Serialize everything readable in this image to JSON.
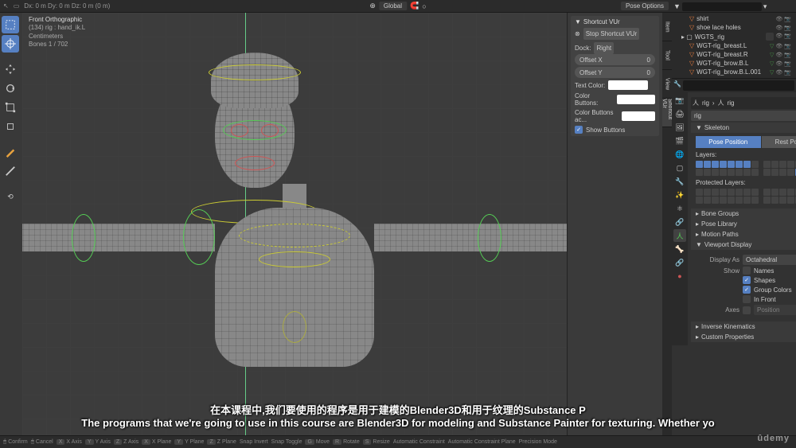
{
  "header": {
    "transform": "Dx: 0 m   Dy: 0 m   Dz: 0 m (0 m)",
    "orientation": "Global",
    "overlays": "Pose Options"
  },
  "viewport": {
    "view_name": "Front Orthographic",
    "object": "(134) rig : hand_ik.L",
    "units": "Centimeters",
    "bones": "Bones    1 / 702"
  },
  "shortcut_panel": {
    "title": "Shortcut VUr",
    "stop": "Stop Shortcut VUr",
    "dock_label": "Dock:",
    "dock_value": "Right",
    "offset_x_label": "Offset X",
    "offset_x_value": "0",
    "offset_y_label": "Offset Y",
    "offset_y_value": "0",
    "text_color": "Text Color:",
    "color_buttons": "Color Buttons:",
    "color_buttons_ac": "Color Buttons ac...",
    "show_buttons": "Show Buttons"
  },
  "tabs": {
    "item": "Item",
    "tool": "Tool",
    "view": "View",
    "shortcut": "Shortcut VUr"
  },
  "outliner": {
    "items": [
      {
        "name": "shirt"
      },
      {
        "name": "shoe lace holes"
      },
      {
        "name": "WGTS_rig"
      },
      {
        "name": "WGT-rig_breast.L"
      },
      {
        "name": "WGT-rig_breast.R"
      },
      {
        "name": "WGT-rig_brow.B.L"
      },
      {
        "name": "WGT-rig_brow.B.L.001"
      }
    ]
  },
  "properties": {
    "search": "",
    "breadcrumb": {
      "armature": "rig",
      "rig": "rig"
    },
    "datablock": "rig",
    "skeleton": {
      "title": "Skeleton",
      "pose": "Pose Position",
      "rest": "Rest Position",
      "layers": "Layers:",
      "protected": "Protected Layers:"
    },
    "sections": {
      "bone_groups": "Bone Groups",
      "pose_library": "Pose Library",
      "motion_paths": "Motion Paths",
      "viewport_display": "Viewport Display",
      "ik": "Inverse Kinematics",
      "custom": "Custom Properties"
    },
    "display": {
      "display_as_label": "Display As",
      "display_as_value": "Octahedral",
      "show_label": "Show",
      "names": "Names",
      "shapes": "Shapes",
      "group_colors": "Group Colors",
      "in_front": "In Front",
      "axes_label": "Axes",
      "position": "Position"
    }
  },
  "statusbar": {
    "items": [
      "Confirm",
      "Cancel",
      "X Axis",
      "Y Axis",
      "Z Axis",
      "X Plane",
      "Y Plane",
      "Z Plane",
      "Snap Invert",
      "Snap Toggle",
      "Move",
      "Rotate",
      "Resize",
      "Automatic Constraint",
      "Automatic Constraint Plane",
      "Precision Mode"
    ],
    "keys": [
      "",
      "",
      "X",
      "Y",
      "Z",
      "X",
      "Y",
      "Z",
      "",
      "",
      "G",
      "R",
      "S",
      "",
      "",
      ""
    ]
  },
  "subtitle": {
    "cn": "在本课程中,我们要使用的程序是用于建模的Blender3D和用于纹理的Substance P",
    "en": "The programs that we're going to use in this course are Blender3D for modeling and Substance Painter for texturing. Whether yo"
  },
  "watermark": "ûdemy"
}
